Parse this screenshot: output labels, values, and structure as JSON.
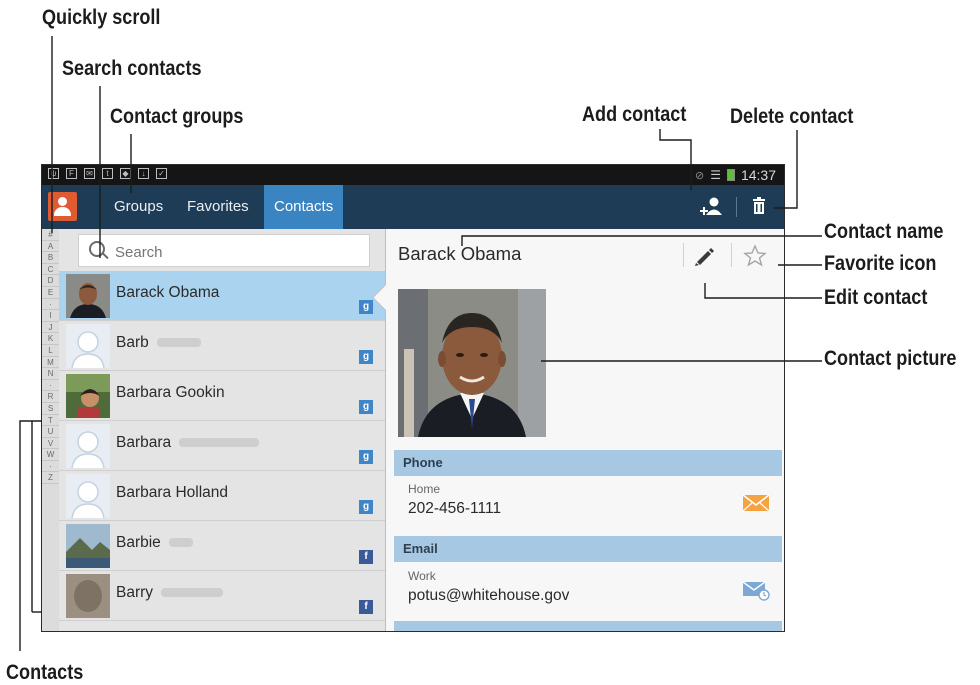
{
  "callouts": {
    "quickly_scroll": "Quickly scroll",
    "search_contacts": "Search contacts",
    "contact_groups": "Contact groups",
    "add_contact": "Add contact",
    "delete_contact": "Delete contact",
    "contact_name": "Contact name",
    "favorite_icon": "Favorite icon",
    "edit_contact": "Edit contact",
    "contact_picture": "Contact picture",
    "contacts": "Contacts"
  },
  "status_bar": {
    "time": "14:37"
  },
  "tabs": [
    {
      "label": "Groups",
      "active": false
    },
    {
      "label": "Favorites",
      "active": false
    },
    {
      "label": "Contacts",
      "active": true
    }
  ],
  "index_letters": [
    "#",
    "A",
    "B",
    "C",
    "D",
    "E",
    "·",
    "I",
    "J",
    "K",
    "L",
    "M",
    "N",
    "·",
    "R",
    "S",
    "T",
    "U",
    "V",
    "W",
    "·",
    "Z"
  ],
  "search": {
    "placeholder": "Search"
  },
  "contacts": [
    {
      "first": "Barack Obama",
      "source": "g",
      "source_icon": "google-badge-icon",
      "selected": true,
      "photo": "obama"
    },
    {
      "first": "Barb",
      "source": "g",
      "source_icon": "google-badge-icon",
      "selected": false,
      "photo": "silhouette"
    },
    {
      "first": "Barbara Gookin",
      "source": "g",
      "source_icon": "google-badge-icon",
      "selected": false,
      "photo": "outdoor"
    },
    {
      "first": "Barbara",
      "source": "g",
      "source_icon": "google-badge-icon",
      "selected": false,
      "photo": "silhouette"
    },
    {
      "first": "Barbara Holland",
      "source": "g",
      "source_icon": "google-badge-icon",
      "selected": false,
      "photo": "silhouette"
    },
    {
      "first": "Barbie",
      "source": "f",
      "source_icon": "facebook-badge-icon",
      "selected": false,
      "photo": "landscape"
    },
    {
      "first": "Barry",
      "source": "f",
      "source_icon": "facebook-badge-icon",
      "selected": false,
      "photo": "blur"
    }
  ],
  "detail": {
    "name": "Barack Obama",
    "phone_header": "Phone",
    "phone_label": "Home",
    "phone_value": "202-456-1111",
    "email_header": "Email",
    "email_label": "Work",
    "email_value": "potus@whitehouse.gov"
  },
  "colors": {
    "action_bar": "#1f3c56",
    "active_tab": "#3b84c2",
    "selected_row": "#a9d3ee",
    "section_header": "#a7c8e3",
    "app_icon": "#e05b32"
  }
}
